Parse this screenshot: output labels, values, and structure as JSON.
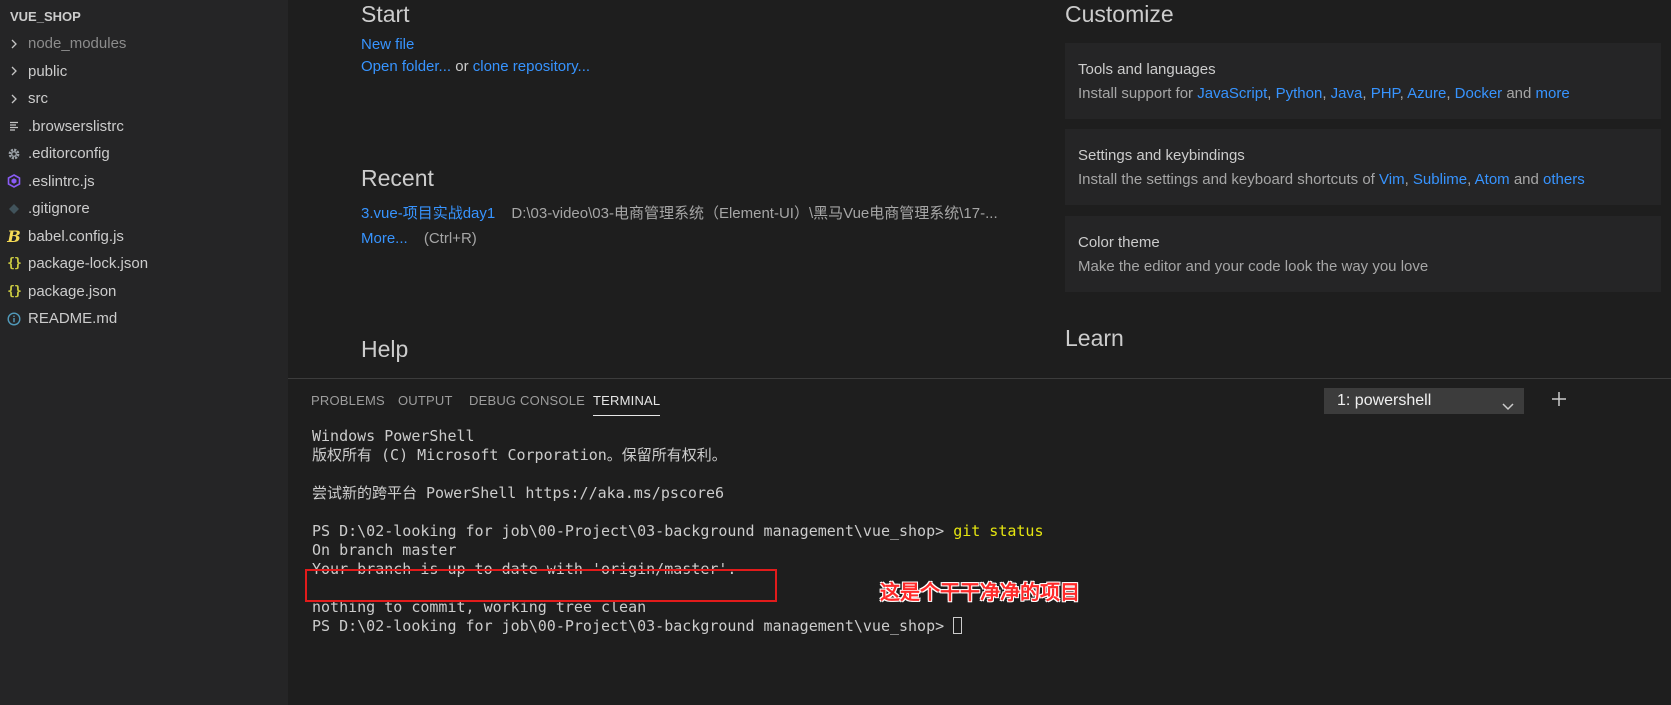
{
  "explorer": {
    "folder_title": "VUE_SHOP",
    "items": [
      {
        "label": "node_modules",
        "icon": "chevron-right-icon"
      },
      {
        "label": "public",
        "icon": "chevron-right-icon"
      },
      {
        "label": "src",
        "icon": "chevron-right-icon"
      },
      {
        "label": ".browserslistrc",
        "icon": "lines-file-icon"
      },
      {
        "label": ".editorconfig",
        "icon": "gear-icon"
      },
      {
        "label": ".eslintrc.js",
        "icon": "eslint-icon"
      },
      {
        "label": ".gitignore",
        "icon": "git-diamond-icon"
      },
      {
        "label": "babel.config.js",
        "icon": "babel-icon",
        "glyph": "B"
      },
      {
        "label": "package-lock.json",
        "icon": "json-braces-icon",
        "glyph": "{}"
      },
      {
        "label": "package.json",
        "icon": "json-braces-icon",
        "glyph": "{}"
      },
      {
        "label": "README.md",
        "icon": "info-icon"
      }
    ]
  },
  "welcome": {
    "start": {
      "heading": "Start",
      "new_file": "New file",
      "open_folder": "Open folder...",
      "or_text": " or ",
      "clone_repo": "clone repository..."
    },
    "recent": {
      "heading": "Recent",
      "item_name": "3.vue-项目实战day1",
      "item_path": "D:\\03-video\\03-电商管理系统（Element-UI）\\黑马Vue电商管理系统\\17-...",
      "more": "More...",
      "more_shortcut": "(Ctrl+R)"
    },
    "help": {
      "heading": "Help"
    },
    "customize": {
      "heading": "Customize",
      "tools": {
        "title": "Tools and languages",
        "prefix": "Install support for ",
        "links": [
          "JavaScript",
          "Python",
          "Java",
          "PHP",
          "Azure",
          "Docker"
        ],
        "sep": ", ",
        "and_text": " and ",
        "more": "more"
      },
      "settings": {
        "title": "Settings and keybindings",
        "prefix": "Install the settings and keyboard shortcuts of ",
        "links": [
          "Vim",
          "Sublime",
          "Atom"
        ],
        "sep": ", ",
        "and_text": " and ",
        "more": "others"
      },
      "theme": {
        "title": "Color theme",
        "desc": "Make the editor and your code look the way you love"
      }
    },
    "learn": {
      "heading": "Learn"
    }
  },
  "panel": {
    "tabs": [
      "PROBLEMS",
      "OUTPUT",
      "DEBUG CONSOLE",
      "TERMINAL"
    ],
    "active_tab": "TERMINAL",
    "terminal_select": "1: powershell",
    "add_terminal": "+"
  },
  "terminal": {
    "line1": "Windows PowerShell",
    "line2": "版权所有 (C) Microsoft Corporation。保留所有权利。",
    "line3": "尝试新的跨平台 PowerShell https://aka.ms/pscore6",
    "prompt": "PS D:\\02-looking for job\\00-Project\\03-background management\\vue_shop> ",
    "command": "git status",
    "out1": "On branch master",
    "out2": "Your branch is up to date with 'origin/master'.",
    "out3": "nothing to commit, working tree clean"
  },
  "annotation": "这是个干干净净的项目",
  "colors": {
    "link": "#3794ff",
    "annotation": "#ff2a2a",
    "highlight_box": "#e21b1b",
    "command": "#e5e510"
  }
}
